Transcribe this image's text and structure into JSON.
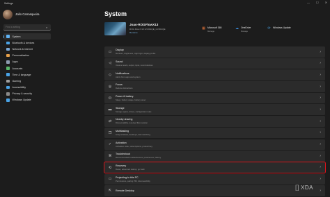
{
  "window": {
    "title": "Settings",
    "controls": [
      "—",
      "☐",
      "✕"
    ]
  },
  "user": {
    "name": "João Carrasqueira",
    "email": ""
  },
  "search": {
    "placeholder": "Find a setting"
  },
  "nav": [
    {
      "label": "System",
      "active": true,
      "color": "#5fb2f2"
    },
    {
      "label": "Bluetooth & devices",
      "color": "#4aa3e6"
    },
    {
      "label": "Network & internet",
      "color": "#7aa9d8"
    },
    {
      "label": "Personalization",
      "color": "#e6a04a"
    },
    {
      "label": "Apps",
      "color": "#8e9bb0"
    },
    {
      "label": "Accounts",
      "color": "#58b66a"
    },
    {
      "label": "Time & language",
      "color": "#4aa3e6"
    },
    {
      "label": "Gaming",
      "color": "#9e9e9e"
    },
    {
      "label": "Accessibility",
      "color": "#4aa3e6"
    },
    {
      "label": "Privacy & security",
      "color": "#8a8a8a"
    },
    {
      "label": "Windows Update",
      "color": "#4aa3e6"
    }
  ],
  "page": {
    "title": "System"
  },
  "device": {
    "name": "Joao-ROGFlowX13",
    "model": "ROG Flow X13 GV301QE_GV301QE",
    "rename": "Rename"
  },
  "quick_links": [
    {
      "title": "Microsoft 365",
      "sub": "Manage",
      "icon": "microsoft-365-icon",
      "glyph": "▦",
      "color": "#e8773a"
    },
    {
      "title": "OneDrive",
      "sub": "Manage",
      "icon": "onedrive-icon",
      "glyph": "☁",
      "color": "#3b8ee0"
    },
    {
      "title": "Windows Update",
      "sub": "",
      "icon": "windows-update-icon",
      "glyph": "⟳",
      "color": "#4aa3e6"
    }
  ],
  "settings_rows": [
    {
      "title": "Display",
      "sub": "Monitors, brightness, night light, display profile",
      "icon": "display-icon",
      "glyph": "▭"
    },
    {
      "title": "Sound",
      "sub": "Volume levels, output, input, sound devices",
      "icon": "sound-icon",
      "glyph": "◁"
    },
    {
      "title": "Notifications",
      "sub": "Alerts from apps and system",
      "icon": "notifications-icon",
      "glyph": "◇"
    },
    {
      "title": "Focus",
      "sub": "Reduce distractions",
      "icon": "focus-icon",
      "glyph": "◎"
    },
    {
      "title": "Power & battery",
      "sub": "Sleep, battery usage, battery saver",
      "icon": "power-icon",
      "glyph": "⏻"
    },
    {
      "title": "Storage",
      "sub": "Storage space, drives, configuration rules",
      "icon": "storage-icon",
      "glyph": "▬"
    },
    {
      "title": "Nearby sharing",
      "sub": "Discoverability, received files location",
      "icon": "nearby-sharing-icon",
      "glyph": "⇄"
    },
    {
      "title": "Multitasking",
      "sub": "Snap windows, desktops, task switching",
      "icon": "multitasking-icon",
      "glyph": "❐"
    },
    {
      "title": "Activation",
      "sub": "Activation state, subscriptions, product key",
      "icon": "activation-icon",
      "glyph": "✓"
    },
    {
      "title": "Troubleshoot",
      "sub": "Recommended troubleshooters, preferences, history",
      "icon": "troubleshoot-icon",
      "glyph": "⚒"
    },
    {
      "title": "Recovery",
      "sub": "Reset, advanced startup, go back",
      "icon": "recovery-icon",
      "glyph": "⟲",
      "highlighted": true
    },
    {
      "title": "Projecting to this PC",
      "sub": "Permissions, pairing PIN, discoverability",
      "icon": "projecting-icon",
      "glyph": "▭"
    },
    {
      "title": "Remote Desktop",
      "sub": "",
      "icon": "remote-desktop-icon",
      "glyph": "⇱"
    }
  ],
  "watermark": {
    "text": "XDA",
    "mark": "[]"
  },
  "colors": {
    "accent": "#5fb2f2",
    "highlight_border": "#d9141b",
    "background": "#1c1c1c",
    "card": "#2b2b2b"
  }
}
